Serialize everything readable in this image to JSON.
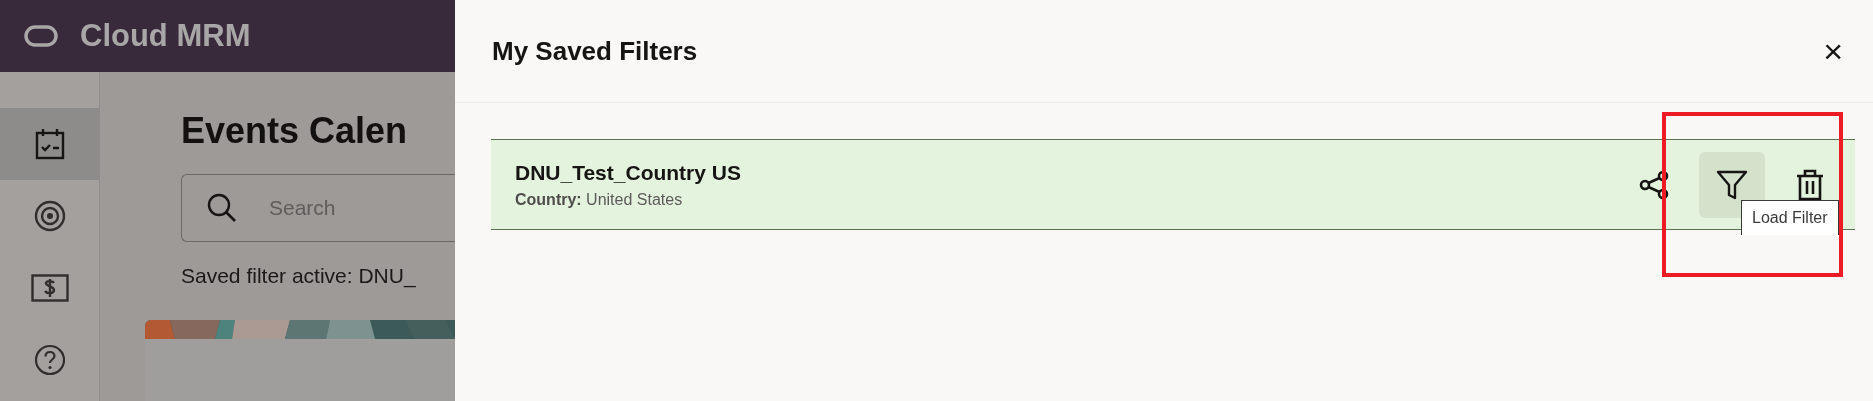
{
  "header": {
    "title": "Cloud MRM"
  },
  "sidebar": {
    "items": [
      {
        "kind": "calendar",
        "selected": true
      },
      {
        "kind": "target",
        "selected": false
      },
      {
        "kind": "money",
        "selected": false
      },
      {
        "kind": "help",
        "selected": false
      }
    ]
  },
  "page": {
    "title": "Events Calen",
    "search": {
      "placeholder": "Search"
    },
    "saved_filter_text": "Saved filter active: DNU_"
  },
  "drawer": {
    "title": "My Saved Filters",
    "close": "×",
    "filters": [
      {
        "name": "DNU_Test_Country US",
        "detail": "**Country:** United States",
        "selected": true,
        "actions": [
          {
            "kind": "share",
            "hovered": false
          },
          {
            "kind": "load",
            "hovered": true,
            "tooltip": "Load Filter"
          },
          {
            "kind": "delete",
            "hovered": false
          }
        ]
      }
    ]
  },
  "annotation": {
    "kind": "highlight-box",
    "color": "#ed1c24"
  }
}
